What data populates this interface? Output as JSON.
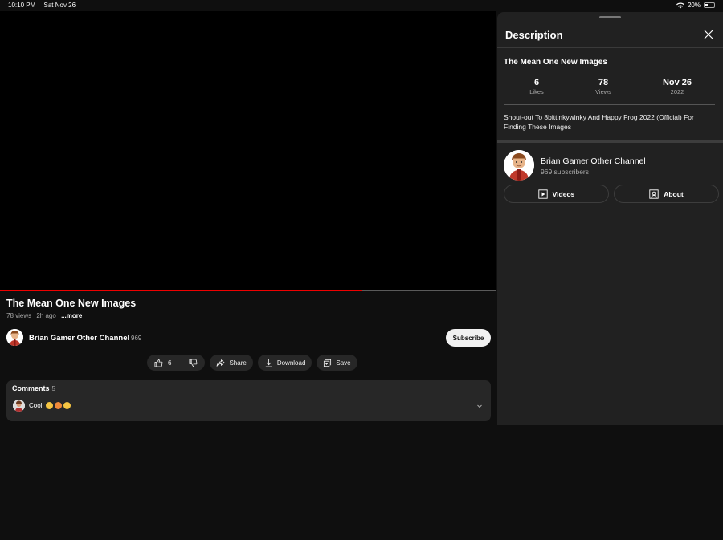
{
  "status_bar": {
    "time": "10:10 PM",
    "date": "Sat Nov 26",
    "battery": "20%"
  },
  "player": {
    "progress_fraction": 0.73
  },
  "video": {
    "title": "The Mean One New Images",
    "views": "78 views",
    "age": "2h ago",
    "more": "...more"
  },
  "channel": {
    "name": "Brian Gamer Other Channel",
    "subs_short": "969",
    "subscribe_label": "Subscribe"
  },
  "actions": {
    "likes": "6",
    "share": "Share",
    "download": "Download",
    "save": "Save"
  },
  "comments": {
    "header": "Comments",
    "count": "5",
    "top_comment": "Cool"
  },
  "panel": {
    "title": "Description",
    "video_title": "The Mean One New Images",
    "stats": [
      {
        "value": "6",
        "label": "Likes"
      },
      {
        "value": "78",
        "label": "Views"
      },
      {
        "value": "Nov 26",
        "label": "2022"
      }
    ],
    "description": "Shout-out To 8bittinkywinky And Happy Frog 2022 (Official) For Finding These Images",
    "channel_name": "Brian Gamer Other Channel",
    "channel_subs": "969 subscribers",
    "videos_button": "Videos",
    "about_button": "About"
  }
}
